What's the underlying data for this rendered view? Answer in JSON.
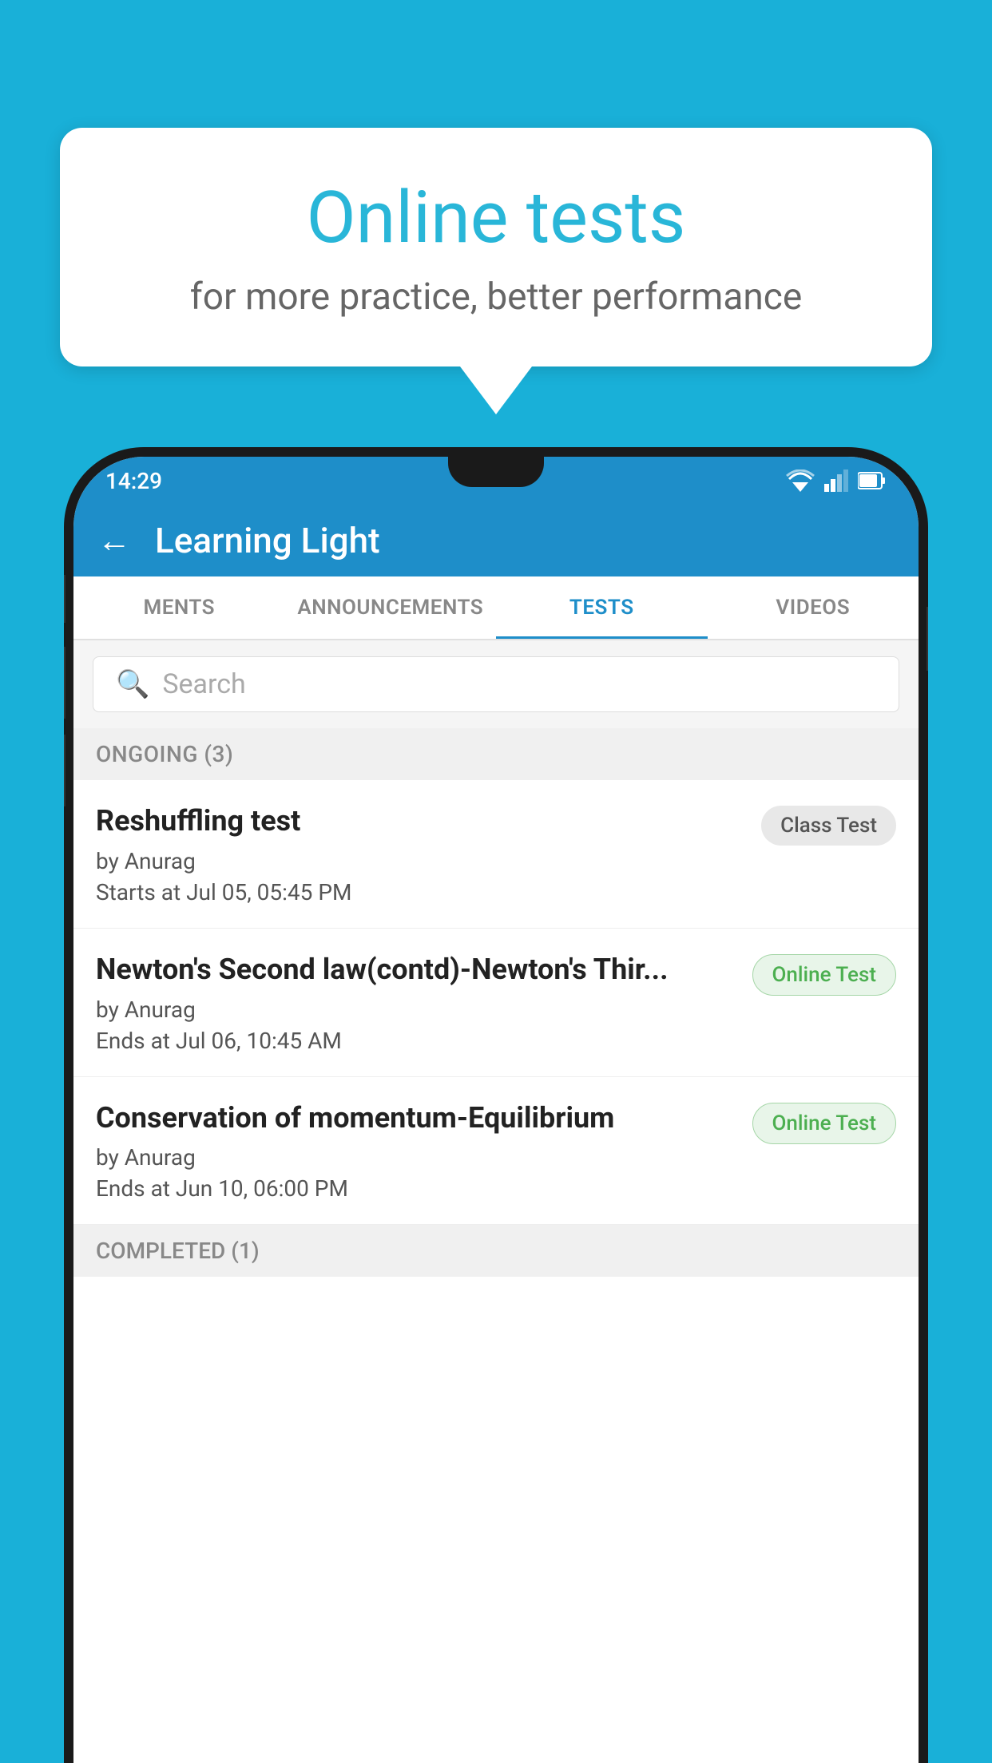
{
  "background_color": "#19b0d8",
  "speech_bubble": {
    "title": "Online tests",
    "subtitle": "for more practice, better performance"
  },
  "phone": {
    "status_bar": {
      "time": "14:29"
    },
    "header": {
      "title": "Learning Light",
      "back_label": "←"
    },
    "tabs": [
      {
        "label": "MENTS",
        "active": false
      },
      {
        "label": "ANNOUNCEMENTS",
        "active": false
      },
      {
        "label": "TESTS",
        "active": true
      },
      {
        "label": "VIDEOS",
        "active": false
      }
    ],
    "search": {
      "placeholder": "Search"
    },
    "section_ongoing": {
      "label": "ONGOING (3)"
    },
    "tests": [
      {
        "name": "Reshuffling test",
        "author": "by Anurag",
        "date": "Starts at  Jul 05, 05:45 PM",
        "badge": "Class Test",
        "badge_type": "class"
      },
      {
        "name": "Newton's Second law(contd)-Newton's Thir...",
        "author": "by Anurag",
        "date": "Ends at  Jul 06, 10:45 AM",
        "badge": "Online Test",
        "badge_type": "online"
      },
      {
        "name": "Conservation of momentum-Equilibrium",
        "author": "by Anurag",
        "date": "Ends at  Jun 10, 06:00 PM",
        "badge": "Online Test",
        "badge_type": "online"
      }
    ],
    "section_completed": {
      "label": "COMPLETED (1)"
    }
  }
}
